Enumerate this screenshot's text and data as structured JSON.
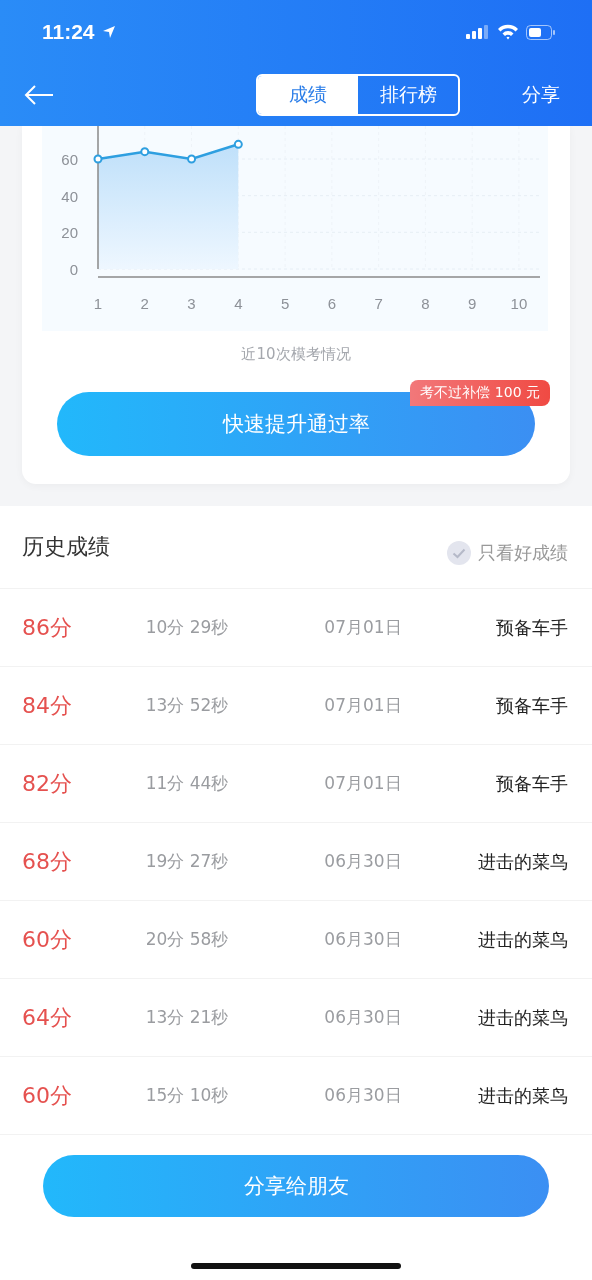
{
  "status_bar": {
    "time": "11:24"
  },
  "nav": {
    "tabs": [
      {
        "label": "成绩",
        "selected": true
      },
      {
        "label": "排行榜",
        "selected": false
      }
    ],
    "action": "分享"
  },
  "chart": {
    "caption": "近10次模考情况",
    "chart_data": {
      "type": "area",
      "x": [
        1,
        2,
        3,
        4
      ],
      "series": [
        {
          "color": "#2e9fe0",
          "values": [
            60,
            64,
            60,
            68
          ]
        }
      ],
      "xlim": [
        1,
        10.45
      ],
      "grid": true,
      "ylim": [
        0,
        78
      ],
      "yticks": [
        0,
        20,
        40,
        60
      ],
      "xticks": [
        1,
        2,
        3,
        4,
        5,
        6,
        7,
        8,
        9,
        10
      ]
    }
  },
  "promo": {
    "button": "快速提升通过率",
    "badge": "考不过补偿 100 元"
  },
  "history": {
    "title": "历史成绩",
    "filter": {
      "label": "只看好成绩",
      "checked": false
    },
    "rows": [
      {
        "score": "86分",
        "duration": "10分 29秒",
        "date": "07月01日",
        "level": "预备车手"
      },
      {
        "score": "84分",
        "duration": "13分 52秒",
        "date": "07月01日",
        "level": "预备车手"
      },
      {
        "score": "82分",
        "duration": "11分 44秒",
        "date": "07月01日",
        "level": "预备车手"
      },
      {
        "score": "68分",
        "duration": "19分 27秒",
        "date": "06月30日",
        "level": "进击的菜鸟"
      },
      {
        "score": "60分",
        "duration": "20分 58秒",
        "date": "06月30日",
        "level": "进击的菜鸟"
      },
      {
        "score": "64分",
        "duration": "13分 21秒",
        "date": "06月30日",
        "level": "进击的菜鸟"
      },
      {
        "score": "60分",
        "duration": "15分 10秒",
        "date": "06月30日",
        "level": "进击的菜鸟"
      }
    ]
  },
  "share_button": "分享给朋友"
}
